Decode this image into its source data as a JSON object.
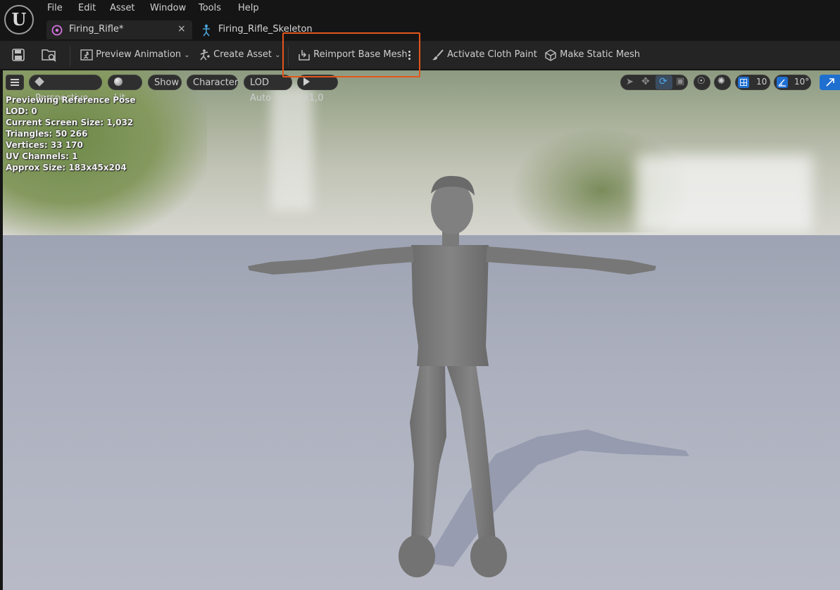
{
  "menu": [
    "File",
    "Edit",
    "Asset",
    "Window",
    "Tools",
    "Help"
  ],
  "tabs": {
    "active": {
      "label": "Firing_Rifle*",
      "close": "×"
    },
    "second": {
      "label": "Firing_Rifle_Skeleton"
    }
  },
  "toolbar": {
    "preview_animation": "Preview Animation",
    "create_asset": "Create Asset",
    "reimport": "Reimport Base Mesh",
    "cloth_paint": "Activate Cloth Paint",
    "static_mesh": "Make Static Mesh"
  },
  "viewport_toolbar": {
    "perspective": "Perspective",
    "lit": "Lit",
    "show": "Show",
    "character": "Character",
    "lod": "LOD Auto",
    "speed": "x1,0",
    "grid_snap": "10",
    "rotation_snap": "10°"
  },
  "stats": [
    "Previewing Reference Pose",
    "LOD: 0",
    "Current Screen Size: 1,032",
    "Triangles: 50 266",
    "Vertices: 33 170",
    "UV Channels: 1",
    "Approx Size: 183x45x204"
  ],
  "colors": {
    "highlight": "#e2561b",
    "accent_blue": "#1f6fd1"
  }
}
